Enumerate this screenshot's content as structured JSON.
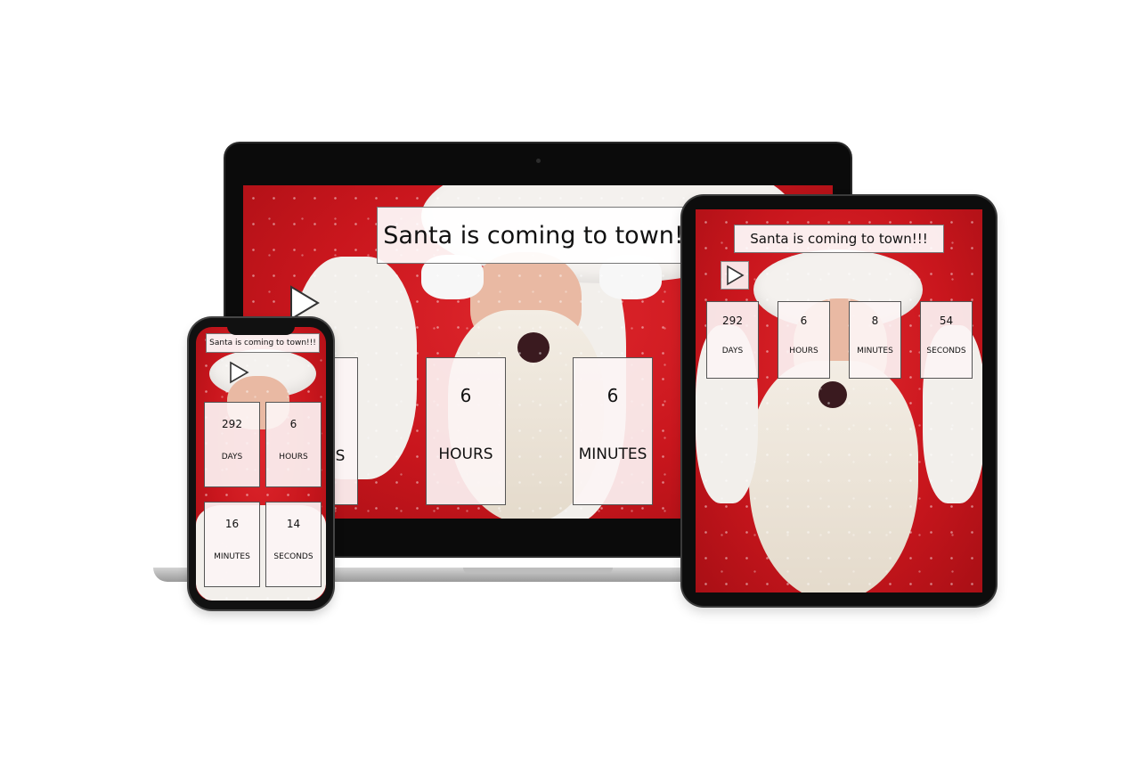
{
  "page": {
    "title": "Santa is coming to town!!!"
  },
  "laptop": {
    "title": "Santa is coming to town!",
    "play_icon": "play-icon",
    "tiles": [
      {
        "value": "",
        "label": "S"
      },
      {
        "value": "6",
        "label": "HOURS"
      },
      {
        "value": "6",
        "label": "MINUTES"
      }
    ]
  },
  "tablet": {
    "title": "Santa is coming to town!!!",
    "play_icon": "play-icon",
    "tiles": [
      {
        "value": "292",
        "label": "DAYS"
      },
      {
        "value": "6",
        "label": "HOURS"
      },
      {
        "value": "8",
        "label": "MINUTES"
      },
      {
        "value": "54",
        "label": "SECONDS"
      }
    ]
  },
  "phone": {
    "title": "Santa is coming to town!!!",
    "play_icon": "play-icon",
    "tiles": [
      {
        "value": "292",
        "label": "DAYS"
      },
      {
        "value": "6",
        "label": "HOURS"
      },
      {
        "value": "16",
        "label": "MINUTES"
      },
      {
        "value": "14",
        "label": "SECONDS"
      }
    ]
  },
  "colors": {
    "background_red": "#c9161d",
    "tile_bg": "#fcf4f4",
    "device_frame": "#0b0b0b"
  }
}
